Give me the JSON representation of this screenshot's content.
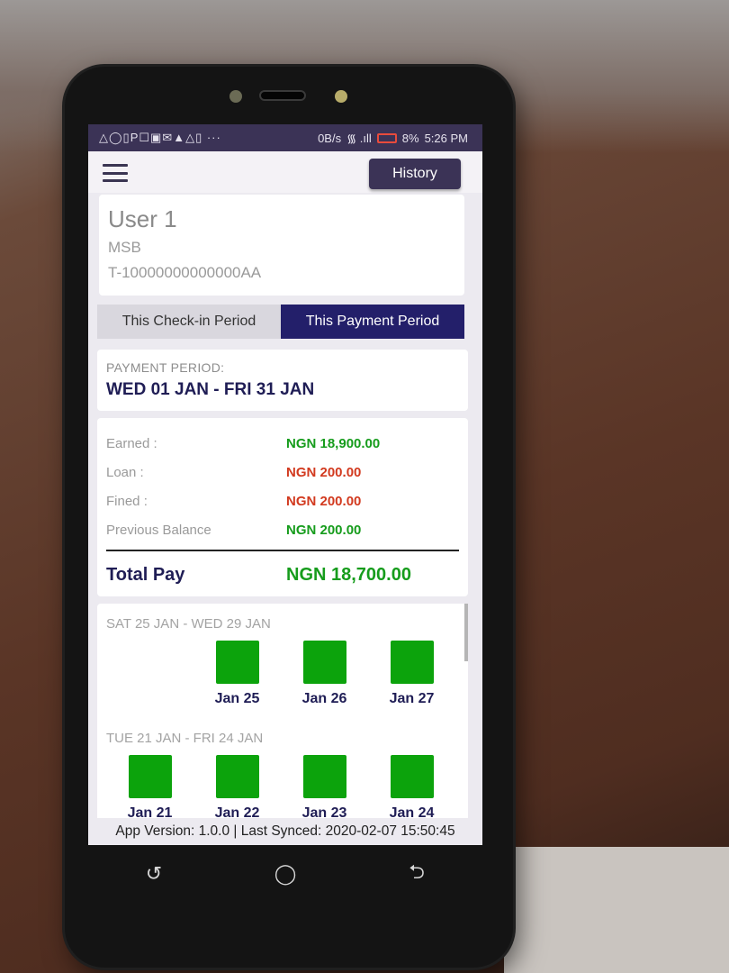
{
  "status_bar": {
    "left_icons": "△◯▯P☐▣✉▲△▯ ···",
    "network": "0B/s",
    "signal": "᯾ .ıll",
    "battery": "8%",
    "time": "5:26 PM"
  },
  "appbar": {
    "history_label": "History"
  },
  "user": {
    "name": "User 1",
    "org": "MSB",
    "id": "T-10000000000000AA"
  },
  "tabs": [
    {
      "label": "This Check-in Period",
      "active": false
    },
    {
      "label": "This Payment Period",
      "active": true
    }
  ],
  "period": {
    "label": "PAYMENT PERIOD:",
    "value": "WED 01 JAN - FRI 31 JAN"
  },
  "payments": {
    "rows": [
      {
        "label": "Earned :",
        "value": "NGN 18,900.00",
        "color": "#169c1c"
      },
      {
        "label": "Loan :",
        "value": "NGN 200.00",
        "color": "#d23a1f"
      },
      {
        "label": "Fined :",
        "value": "NGN 200.00",
        "color": "#d23a1f"
      },
      {
        "label": "Previous Balance",
        "value": "NGN 200.00",
        "color": "#169c1c"
      }
    ],
    "total_label": "Total Pay",
    "total_value": "NGN 18,700.00"
  },
  "weeks": [
    {
      "label": "SAT 25 JAN - WED 29 JAN",
      "days": [
        "",
        "Jan 25",
        "Jan 26",
        "Jan 27"
      ]
    },
    {
      "label": "TUE 21 JAN - FRI 24 JAN",
      "days": [
        "Jan 21",
        "Jan 22",
        "Jan 23",
        "Jan 24"
      ]
    }
  ],
  "day_box_color": "#0ca30c",
  "footer": "App Version: 1.0.0 | Last Synced: 2020-02-07 15:50:45",
  "nav": {
    "recent": "↺",
    "home": "◯",
    "back": "⮌"
  }
}
